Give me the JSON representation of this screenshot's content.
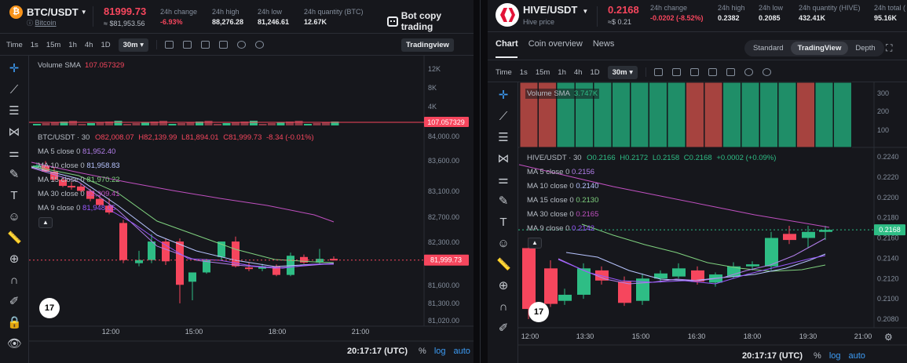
{
  "left": {
    "pair": "BTC/USDT",
    "coin_name": "Bitcoin",
    "price": "81999.73",
    "price_usd": "≈ $81,953.56",
    "stats": [
      {
        "label": "24h change",
        "value": "-6.93%",
        "red": true
      },
      {
        "label": "24h high",
        "value": "88,276.28",
        "red": false
      },
      {
        "label": "24h low",
        "value": "81,246.61",
        "red": false
      },
      {
        "label": "24h quantity (BTC)",
        "value": "12.67K",
        "red": false
      }
    ],
    "bot_button": "Bot copy trading",
    "toolbar": {
      "time_label": "Time",
      "intervals": [
        "1s",
        "15m",
        "1h",
        "4h",
        "1D"
      ],
      "selected_interval": "30m",
      "view_button": "Tradingview"
    },
    "volume_sma_label": "Volume SMA",
    "volume_sma_value": "107.057329",
    "volume_tag": "107.057329",
    "ohlc": {
      "title": "BTC/USDT · 30",
      "o": "O82,008.07",
      "h": "H82,139.99",
      "l": "L81,894.01",
      "c": "C81,999.73",
      "chg": "-8.34 (-0.01%)"
    },
    "ma": [
      {
        "label": "MA 5 close 0",
        "value": "81,952.40",
        "color": "#b37feb"
      },
      {
        "label": "MA 10 close 0",
        "value": "81,958.83",
        "color": "#b7c4ff"
      },
      {
        "label": "MA 15 close 0",
        "value": "81,970.22",
        "color": "#7fd17f"
      },
      {
        "label": "MA 30 close 0",
        "value": "82,309.41",
        "color": "#c050c0"
      },
      {
        "label": "MA 9 close 0",
        "value": "81,948.05",
        "color": "#9b59ff"
      }
    ],
    "price_tag": "81,999.73",
    "vol_axis": [
      "12K",
      "8K",
      "4K"
    ],
    "price_axis": [
      "84,000.00",
      "83,600.00",
      "83,100.00",
      "82,700.00",
      "82,300.00",
      "81,600.00",
      "81,300.00",
      "81,020.00"
    ],
    "time_axis": [
      "12:00",
      "15:00",
      "18:00",
      "21:00"
    ],
    "clock": "20:17:17 (UTC)",
    "pct": "%",
    "log": "log",
    "auto": "auto",
    "tv_logo": "17"
  },
  "right": {
    "pair": "HIVE/USDT",
    "coin_name": "Hive price",
    "price": "0.2168",
    "price_usd": "≈$ 0.21",
    "stats": [
      {
        "label": "24h change",
        "value": "-0.0202 (-8.52%)",
        "red": true
      },
      {
        "label": "24h high",
        "value": "0.2382",
        "red": false
      },
      {
        "label": "24h low",
        "value": "0.2085",
        "red": false
      },
      {
        "label": "24h quantity (HIVE)",
        "value": "432.41K",
        "red": false
      },
      {
        "label": "24h total (",
        "value": "95.16K",
        "red": false
      }
    ],
    "tabs": [
      "Chart",
      "Coin overview",
      "News"
    ],
    "view_modes": [
      "Standard",
      "TradingView",
      "Depth"
    ],
    "toolbar": {
      "time_label": "Time",
      "intervals": [
        "1s",
        "15m",
        "1h",
        "4h",
        "1D"
      ],
      "selected_interval": "30m"
    },
    "volume_sma_label": "Volume SMA",
    "volume_sma_value": "3.747K",
    "ohlc": {
      "title": "HIVE/USDT · 30",
      "o": "O0.2166",
      "h": "H0.2172",
      "l": "L0.2158",
      "c": "C0.2168",
      "chg": "+0.0002 (+0.09%)"
    },
    "ma": [
      {
        "label": "MA 5 close 0",
        "value": "0.2156",
        "color": "#b37feb"
      },
      {
        "label": "MA 10 close 0",
        "value": "0.2140",
        "color": "#b7c4ff"
      },
      {
        "label": "MA 15 close 0",
        "value": "0.2130",
        "color": "#7fd17f"
      },
      {
        "label": "MA 30 close 0",
        "value": "0.2165",
        "color": "#c050c0"
      },
      {
        "label": "MA 9 close 0",
        "value": "0.2142",
        "color": "#9b59ff"
      }
    ],
    "price_tag": "0.2168",
    "vol_axis": [
      "300",
      "200",
      "100"
    ],
    "price_axis": [
      "0.2240",
      "0.2220",
      "0.2200",
      "0.2180",
      "0.2160",
      "0.2140",
      "0.2120",
      "0.2100",
      "0.2080"
    ],
    "time_axis": [
      "12:00",
      "13:30",
      "15:00",
      "16:30",
      "18:00",
      "19:30",
      "21:00"
    ],
    "clock": "20:17:17 (UTC)",
    "pct": "%",
    "log": "log",
    "auto": "auto",
    "tv_logo": "17"
  },
  "colors": {
    "up": "#2ebd85",
    "down": "#f6465d",
    "accent_link": "#3d9cf5"
  }
}
